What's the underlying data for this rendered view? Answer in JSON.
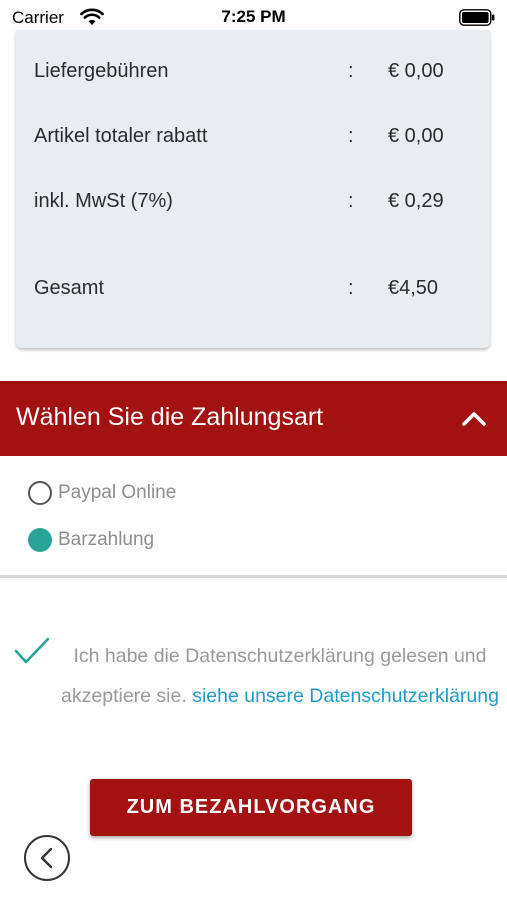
{
  "status_bar": {
    "carrier": "Carrier",
    "time": "7:25 PM"
  },
  "summary": {
    "rows": [
      {
        "label": "Liefergebühren",
        "colon": ":",
        "value": "€ 0,00"
      },
      {
        "label": "Artikel totaler rabatt",
        "colon": ":",
        "value": "€ 0,00"
      },
      {
        "label": "inkl. MwSt (7%)",
        "colon": ":",
        "value": "€ 0,29"
      },
      {
        "label": "Gesamt",
        "colon": ":",
        "value": "€4,50"
      }
    ]
  },
  "payment": {
    "title": "Wählen Sie die Zahlungsart",
    "options": [
      {
        "label": "Paypal Online",
        "selected": false
      },
      {
        "label": "Barzahlung",
        "selected": true
      }
    ]
  },
  "consent": {
    "text": "Ich habe die Datenschutzerklärung gelesen und akzeptiere sie.",
    "link": "siehe unsere Datenschutzerklärung",
    "checked": true
  },
  "actions": {
    "pay_button": "ZUM BEZAHLVORGANG"
  },
  "colors": {
    "brand_red": "#a31111",
    "accent_teal": "#2aa49a",
    "link_blue": "#1f9bcb"
  }
}
